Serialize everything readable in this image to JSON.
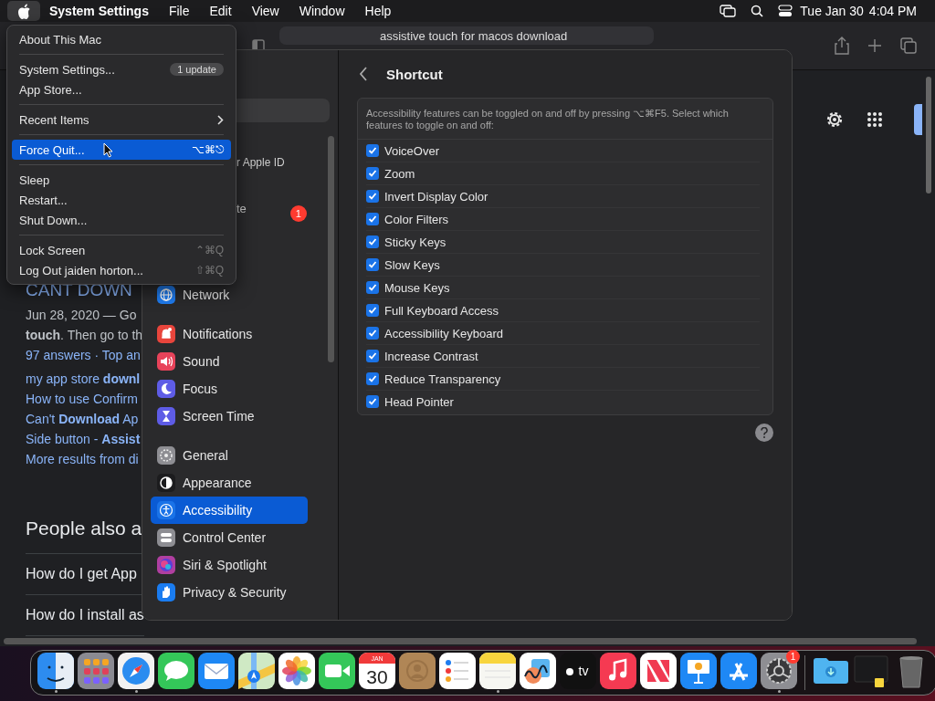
{
  "menu_bar": {
    "app_name": "System Settings",
    "menus": [
      "File",
      "Edit",
      "View",
      "Window",
      "Help"
    ],
    "date": "Tue Jan 30",
    "time": "4:04 PM"
  },
  "apple_menu": {
    "items": [
      {
        "kind": "item",
        "label": "About This Mac",
        "selected": false
      },
      {
        "kind": "separator"
      },
      {
        "kind": "item",
        "label": "System Settings...",
        "badge": "1 update",
        "selected": false
      },
      {
        "kind": "item",
        "label": "App Store...",
        "selected": false
      },
      {
        "kind": "separator"
      },
      {
        "kind": "submenu",
        "label": "Recent Items",
        "selected": false
      },
      {
        "kind": "separator"
      },
      {
        "kind": "item",
        "label": "Force Quit...",
        "shortcut": "⌥⌘⎋",
        "selected": true
      },
      {
        "kind": "separator"
      },
      {
        "kind": "item",
        "label": "Sleep",
        "selected": false
      },
      {
        "kind": "item",
        "label": "Restart...",
        "selected": false
      },
      {
        "kind": "item",
        "label": "Shut Down...",
        "selected": false
      },
      {
        "kind": "separator"
      },
      {
        "kind": "item",
        "label": "Lock Screen",
        "shortcut": "⌃⌘Q",
        "selected": false
      },
      {
        "kind": "item",
        "label": "Log Out jaiden horton...",
        "shortcut": "⇧⌘Q",
        "selected": false
      }
    ]
  },
  "browser": {
    "address": "assistive touch for macos download",
    "results": [
      {
        "kind": "title",
        "text": "CANT DOWN"
      },
      {
        "kind": "snippet",
        "text": "Jun 28, 2020 — Go"
      },
      {
        "kind": "snippet",
        "text": "**touch**. Then go to th"
      },
      {
        "kind": "link",
        "text": "97 answers · Top an"
      },
      {
        "kind": "link",
        "text": "my app store **downl**"
      },
      {
        "kind": "link",
        "text": "How to use Confirm"
      },
      {
        "kind": "link",
        "text": "Can't **Download** Ap"
      },
      {
        "kind": "link",
        "text": "Side button - **Assist**"
      },
      {
        "kind": "link",
        "text": "More results from di"
      },
      {
        "kind": "heading",
        "text": "People also a"
      },
      {
        "kind": "question",
        "text": "How do I get App"
      },
      {
        "kind": "question",
        "text": "How do I install as"
      }
    ]
  },
  "settings": {
    "sidebar": {
      "partial_items": [
        {
          "label": "r Apple ID"
        },
        {
          "label": "te",
          "badge": "1"
        }
      ],
      "groups": [
        [
          {
            "kind": "network",
            "label": "Network",
            "color": "#1f7cf0",
            "selected": false
          }
        ],
        [
          {
            "kind": "notifications",
            "label": "Notifications",
            "color": "#e8453c",
            "selected": false
          },
          {
            "kind": "sound",
            "label": "Sound",
            "color": "#e8435a",
            "selected": false
          },
          {
            "kind": "focus",
            "label": "Focus",
            "color": "#5e5ce6",
            "selected": false
          },
          {
            "kind": "screentime",
            "label": "Screen Time",
            "color": "#5e5ce6",
            "selected": false
          }
        ],
        [
          {
            "kind": "general",
            "label": "General",
            "color": "#8e8e93",
            "selected": false
          },
          {
            "kind": "appearance",
            "label": "Appearance",
            "color": "#1c1c1e",
            "selected": false
          },
          {
            "kind": "accessibility",
            "label": "Accessibility",
            "color": "#1a73e8",
            "selected": true
          },
          {
            "kind": "controlcenter",
            "label": "Control Center",
            "color": "#8e8e93",
            "selected": false
          },
          {
            "kind": "siri",
            "label": "Siri & Spotlight",
            "color": "#b03fa0",
            "selected": false
          },
          {
            "kind": "privacy",
            "label": "Privacy & Security",
            "color": "#1a7cf0",
            "selected": false
          }
        ]
      ]
    },
    "panel": {
      "title": "Shortcut",
      "description": "Accessibility features can be toggled on and off by pressing ⌥⌘F5. Select which features to toggle on and off:",
      "features": [
        {
          "label": "VoiceOver",
          "checked": true
        },
        {
          "label": "Zoom",
          "checked": true
        },
        {
          "label": "Invert Display Color",
          "checked": true
        },
        {
          "label": "Color Filters",
          "checked": true
        },
        {
          "label": "Sticky Keys",
          "checked": true
        },
        {
          "label": "Slow Keys",
          "checked": true
        },
        {
          "label": "Mouse Keys",
          "checked": true
        },
        {
          "label": "Full Keyboard Access",
          "checked": true
        },
        {
          "label": "Accessibility Keyboard",
          "checked": true
        },
        {
          "label": "Increase Contrast",
          "checked": true
        },
        {
          "label": "Reduce Transparency",
          "checked": true
        },
        {
          "label": "Head Pointer",
          "checked": true
        }
      ]
    }
  },
  "dock": {
    "items": [
      {
        "kind": "finder",
        "running": true
      },
      {
        "kind": "launchpad",
        "running": false
      },
      {
        "kind": "safari",
        "running": true
      },
      {
        "kind": "messages",
        "running": false
      },
      {
        "kind": "mail",
        "running": false
      },
      {
        "kind": "maps",
        "running": false
      },
      {
        "kind": "photos",
        "running": false
      },
      {
        "kind": "facetime",
        "running": false
      },
      {
        "kind": "calendar",
        "month": "JAN",
        "day": "30",
        "running": false
      },
      {
        "kind": "contacts",
        "running": false
      },
      {
        "kind": "reminders",
        "running": false
      },
      {
        "kind": "notes",
        "running": true
      },
      {
        "kind": "freeform",
        "running": false
      },
      {
        "kind": "tv",
        "text": "tv",
        "running": false
      },
      {
        "kind": "music",
        "running": false
      },
      {
        "kind": "news",
        "running": false
      },
      {
        "kind": "keynote",
        "running": false
      },
      {
        "kind": "appstore",
        "running": false
      },
      {
        "kind": "settings",
        "badge": "1",
        "running": true
      },
      {
        "kind": "divider"
      },
      {
        "kind": "downloads",
        "running": false
      },
      {
        "kind": "window",
        "running": false
      },
      {
        "kind": "trash",
        "running": false
      }
    ]
  }
}
